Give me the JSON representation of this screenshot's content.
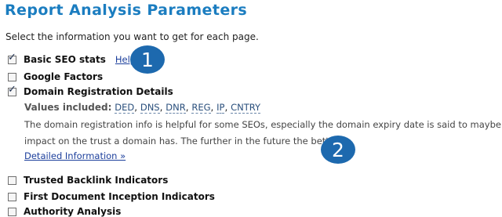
{
  "title": "Report Analysis Parameters",
  "intro": "Select the information you want to get for each page.",
  "options": [
    {
      "label": "Basic SEO stats",
      "checked": true
    },
    {
      "label": "Google Factors",
      "checked": false
    },
    {
      "label": "Domain Registration Details",
      "checked": true
    },
    {
      "label": "Trusted Backlink Indicators",
      "checked": false
    },
    {
      "label": "First Document Inception Indicators",
      "checked": false
    },
    {
      "label": "Authority Analysis",
      "checked": false
    }
  ],
  "help_link": "Help",
  "values_label": "Values included:",
  "values": [
    "DED",
    "DNS",
    "DNR",
    "REG",
    "IP",
    "CNTRY"
  ],
  "description_line1": "The domain registration info is helpful for some SEOs, especially the domain expiry date is said to maybe have",
  "description_line2": "impact on the trust a domain has. The further in the future the better.",
  "detailed_link": "Detailed Information »",
  "badges": [
    "1",
    "2"
  ],
  "colors": {
    "title": "#1b7dc0",
    "badge": "#1d69ae",
    "link": "#1c3f9c"
  }
}
